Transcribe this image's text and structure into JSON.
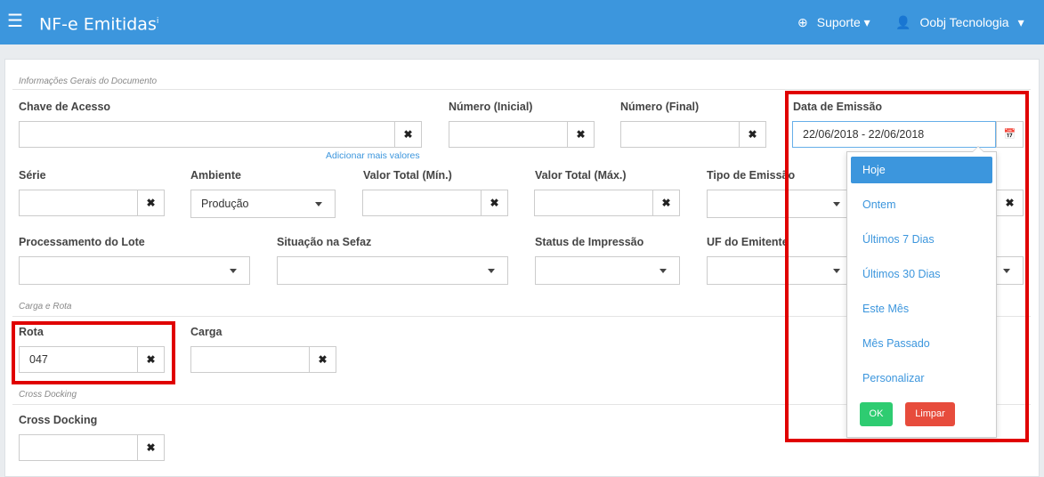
{
  "header": {
    "menu_icon": "☰",
    "title": "NF-e Emitidas",
    "title_sup": "i",
    "support_icon": "⊕",
    "support_label": "Suporte ▾",
    "user_icon": "👤",
    "user_label": "Oobj Tecnologia",
    "user_caret": "▾"
  },
  "sections": {
    "general": "Informações Gerais do Documento",
    "carga_rota": "Carga e Rota",
    "cross_docking": "Cross Docking"
  },
  "fields": {
    "chave_label": "Chave de Acesso",
    "chave_value": "",
    "add_more": "Adicionar mais valores",
    "numero_ini_label": "Número (Inicial)",
    "numero_fim_label": "Número (Final)",
    "data_emissao_label": "Data de Emissão",
    "data_emissao_value": "22/06/2018 - 22/06/2018",
    "serie_label": "Série",
    "ambiente_label": "Ambiente",
    "ambiente_value": "Produção",
    "valor_min_label": "Valor Total (Mín.)",
    "valor_max_label": "Valor Total (Máx.)",
    "tipo_emissao_label": "Tipo de Emissão",
    "processamento_label": "Processamento do Lote",
    "situacao_label": "Situação na Sefaz",
    "status_impressao_label": "Status de Impressão",
    "uf_label": "UF do Emitente",
    "rota_label": "Rota",
    "rota_value": "047",
    "carga_label": "Carga",
    "cross_label": "Cross Docking",
    "clear_icon": "✖",
    "calendar_icon": "📅"
  },
  "date_ranges": {
    "options": [
      "Hoje",
      "Ontem",
      "Últimos 7 Dias",
      "Últimos 30 Dias",
      "Este Mês",
      "Mês Passado",
      "Personalizar"
    ],
    "ok_label": "OK",
    "clear_label": "Limpar"
  },
  "colors": {
    "primary": "#3c96dd",
    "highlight": "#e00000",
    "ok": "#2ecc71",
    "clear": "#e74c3c"
  }
}
